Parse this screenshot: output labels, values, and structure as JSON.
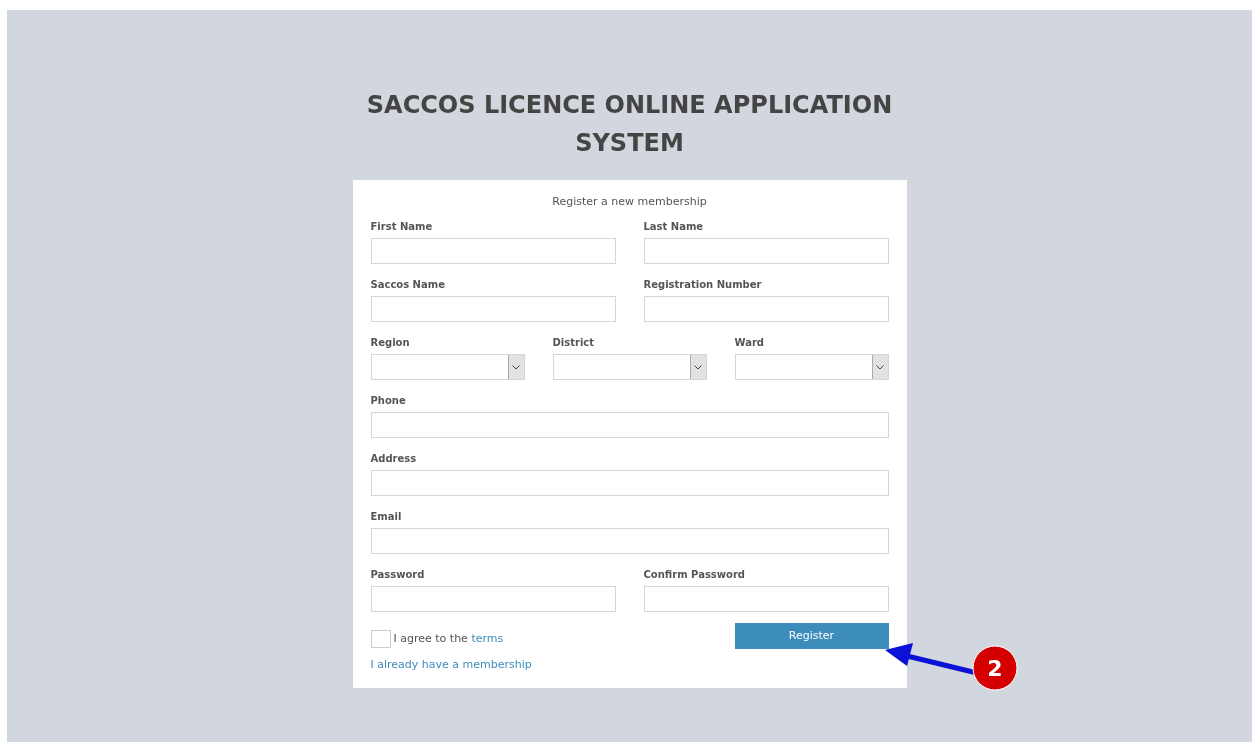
{
  "title": "SACCOS LICENCE ONLINE APPLICATION SYSTEM",
  "form": {
    "heading": "Register a new membership",
    "rows": [
      {
        "fields": [
          {
            "label": "First Name",
            "kind": "text"
          },
          {
            "label": "Last Name",
            "kind": "text"
          }
        ]
      },
      {
        "fields": [
          {
            "label": "Saccos Name",
            "kind": "text"
          },
          {
            "label": "Registration Number",
            "kind": "text"
          }
        ]
      },
      {
        "fields": [
          {
            "label": "Region",
            "kind": "select"
          },
          {
            "label": "District",
            "kind": "select"
          },
          {
            "label": "Ward",
            "kind": "select"
          }
        ]
      },
      {
        "fields": [
          {
            "label": "Phone",
            "kind": "text"
          }
        ]
      },
      {
        "fields": [
          {
            "label": "Address",
            "kind": "text"
          }
        ]
      },
      {
        "fields": [
          {
            "label": "Email",
            "kind": "text"
          }
        ]
      },
      {
        "fields": [
          {
            "label": "Password",
            "kind": "password"
          },
          {
            "label": "Confirm Password",
            "kind": "password"
          }
        ]
      }
    ],
    "agree": {
      "text": "I agree to the",
      "link": "terms",
      "checked": false
    },
    "submit": "Register",
    "login_link": "I already have a membership"
  },
  "annotation": {
    "label": "2"
  }
}
